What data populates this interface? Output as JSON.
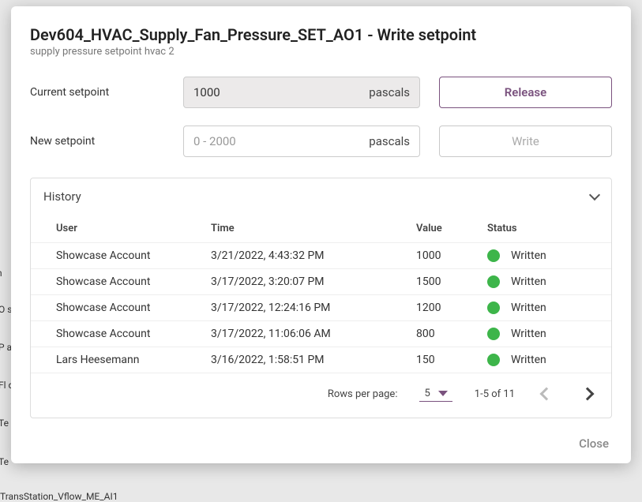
{
  "bg": {
    "a": "h",
    "b": "O\nss",
    "c": "P\na",
    "d": "Fl\noc",
    "e": "Te\na",
    "f": "Te",
    "g": "TransStation_Vflow_ME_AI1"
  },
  "dialog": {
    "title": "Dev604_HVAC_Supply_Fan_Pressure_SET_AO1 - Write setpoint",
    "subtitle": "supply pressure setpoint hvac 2",
    "current_label": "Current setpoint",
    "current_value": "1000",
    "current_unit": "pascals",
    "new_label": "New setpoint",
    "new_placeholder": "0 - 2000",
    "new_unit": "pascals",
    "release_btn": "Release",
    "write_btn": "Write",
    "history_label": "History",
    "columns": {
      "user": "User",
      "time": "Time",
      "value": "Value",
      "status": "Status"
    },
    "rows": [
      {
        "user": "Showcase Account",
        "time": "3/21/2022, 4:43:32 PM",
        "value": "1000",
        "status": "Written"
      },
      {
        "user": "Showcase Account",
        "time": "3/17/2022, 3:20:07 PM",
        "value": "1500",
        "status": "Written"
      },
      {
        "user": "Showcase Account",
        "time": "3/17/2022, 12:24:16 PM",
        "value": "1200",
        "status": "Written"
      },
      {
        "user": "Showcase Account",
        "time": "3/17/2022, 11:06:06 AM",
        "value": "800",
        "status": "Written"
      },
      {
        "user": "Lars Heesemann",
        "time": "3/16/2022, 1:58:51 PM",
        "value": "150",
        "status": "Written"
      }
    ],
    "pager": {
      "rows_label": "Rows per page:",
      "rows_value": "5",
      "range": "1-5 of 11"
    },
    "close": "Close"
  }
}
